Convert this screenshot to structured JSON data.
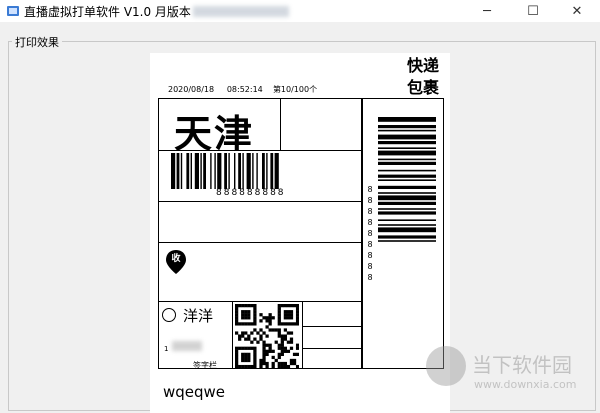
{
  "window": {
    "title": "直播虚拟打单软件 V1.0  月版本",
    "buttons": {
      "minimize": "─",
      "maximize": "☐",
      "close": "✕"
    }
  },
  "group_label": "打印效果",
  "label": {
    "header": {
      "date": "2020/08/18",
      "time": "08:52:14",
      "count": "第10/100个"
    },
    "express_type": "快递\n包裹",
    "destination_city": "天津",
    "barcode_number": "888888888",
    "vertical_number": "888888888",
    "collect_badge": "收",
    "sender_name": "洋洋",
    "sender_prefix": "1",
    "signature_label": "签字栏",
    "footer_text": "wqeqwe"
  },
  "watermark": {
    "brand": "当下软件园",
    "url": "www.downxia.com"
  }
}
